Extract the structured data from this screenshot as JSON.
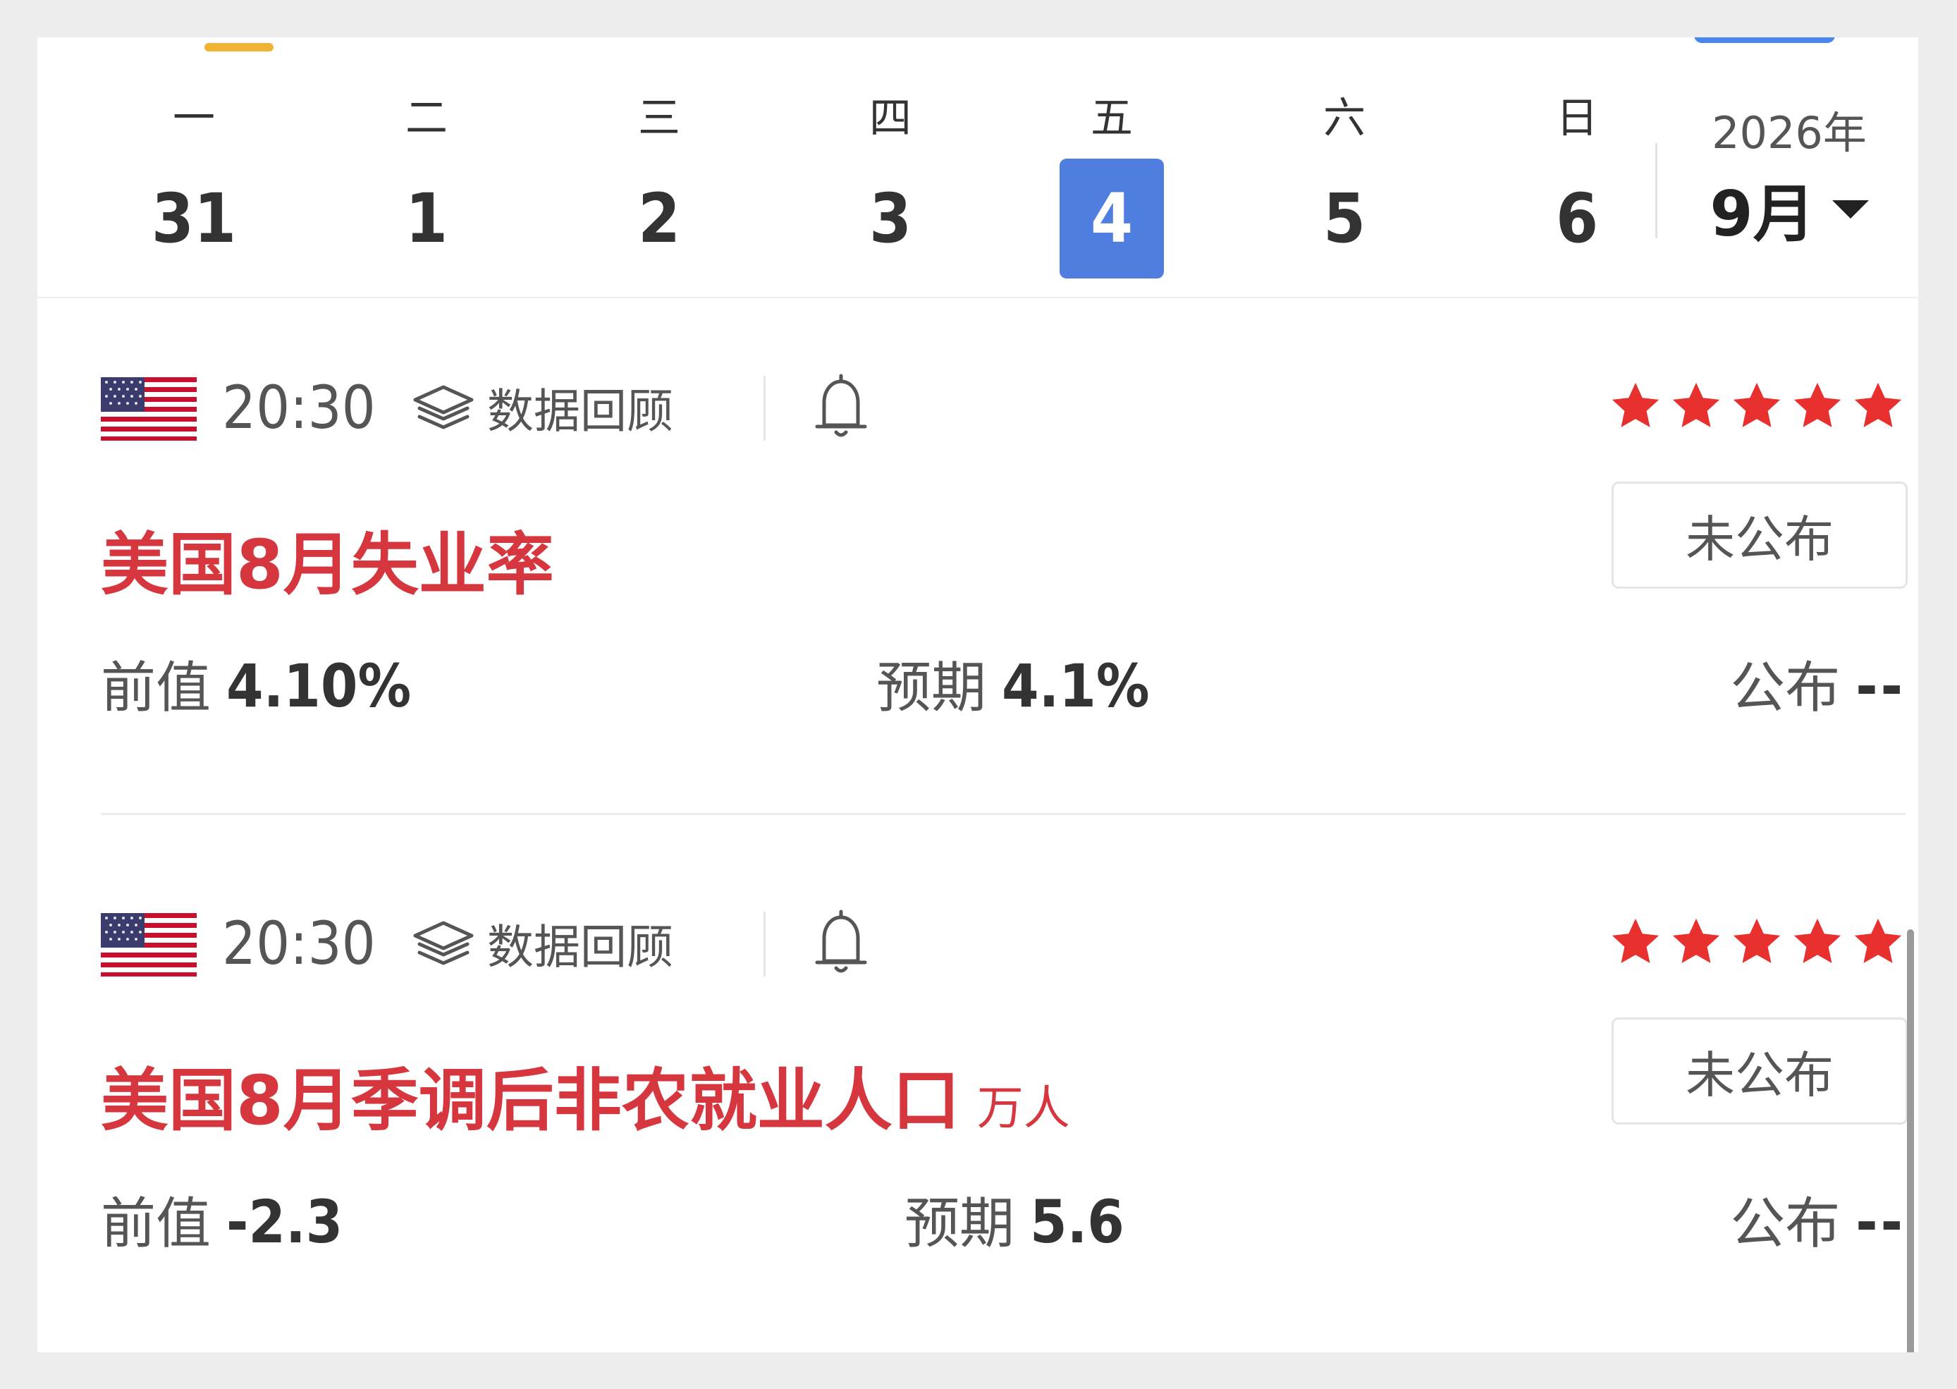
{
  "calendar": {
    "days": [
      {
        "weekday": "一",
        "date": "31",
        "selected": false
      },
      {
        "weekday": "二",
        "date": "1",
        "selected": false
      },
      {
        "weekday": "三",
        "date": "2",
        "selected": false
      },
      {
        "weekday": "四",
        "date": "3",
        "selected": false
      },
      {
        "weekday": "五",
        "date": "4",
        "selected": true
      },
      {
        "weekday": "六",
        "date": "5",
        "selected": false
      },
      {
        "weekday": "日",
        "date": "6",
        "selected": false
      }
    ],
    "year": "2026年",
    "month": "9月"
  },
  "events": [
    {
      "time": "20:30",
      "review_label": "数据回顾",
      "stars": 5,
      "title": "美国8月失业率",
      "unit": "",
      "status": "未公布",
      "prev_label": "前值",
      "prev_value": "4.10%",
      "forecast_label": "预期",
      "forecast_value": "4.1%",
      "actual_label": "公布",
      "actual_value": "--"
    },
    {
      "time": "20:30",
      "review_label": "数据回顾",
      "stars": 5,
      "title": "美国8月季调后非农就业人口",
      "unit": "万人",
      "status": "未公布",
      "prev_label": "前值",
      "prev_value": "-2.3",
      "forecast_label": "预期",
      "forecast_value": "5.6",
      "actual_label": "公布",
      "actual_value": "--"
    }
  ],
  "colors": {
    "accent_blue": "#4f7ee0",
    "title_red": "#d6363d",
    "star_red": "#e8302f",
    "indicator_orange": "#f2b233"
  },
  "icons": {
    "flag": "us-flag-icon",
    "review": "layers-icon",
    "bell": "bell-icon",
    "star": "star-icon",
    "caret": "caret-down-icon"
  }
}
